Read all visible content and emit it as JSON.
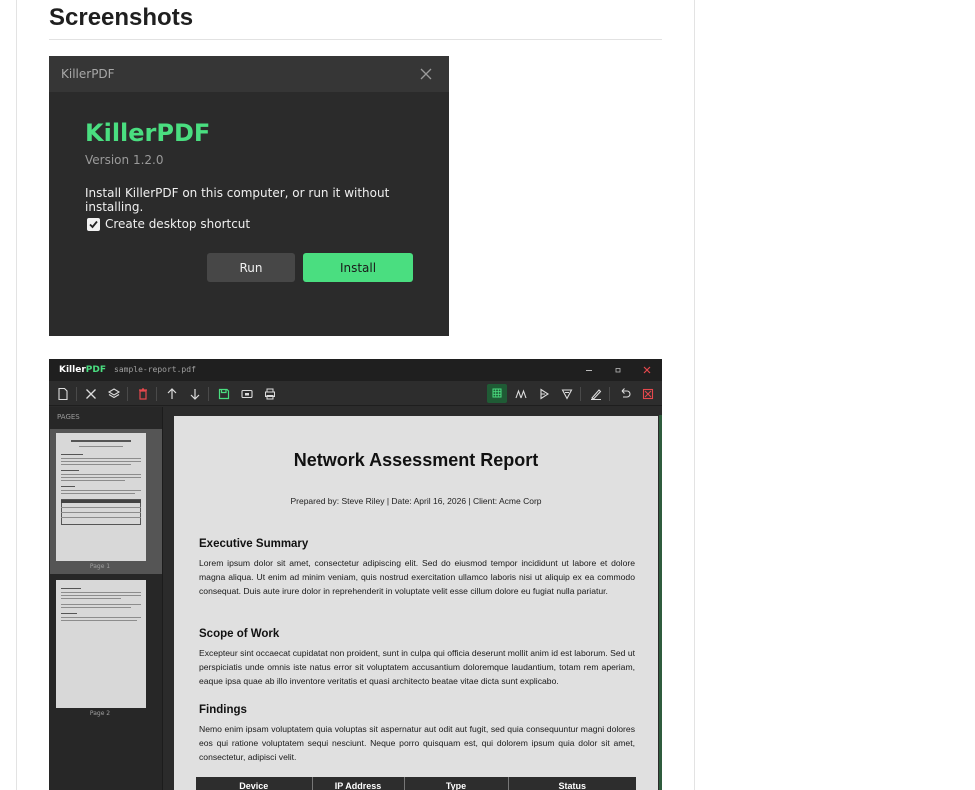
{
  "section": {
    "heading": "Screenshots"
  },
  "installer": {
    "window_title": "KillerPDF",
    "app_name": "KillerPDF",
    "version": "Version 1.2.0",
    "description": "Install KillerPDF on this computer, or run it without installing.",
    "checkbox_label": "Create desktop shortcut",
    "checkbox_checked": true,
    "run_label": "Run",
    "install_label": "Install",
    "accent": "#4ade80"
  },
  "app": {
    "brand_killer": "Killer",
    "brand_pdf": "PDF",
    "filename": "sample-report.pdf",
    "toolbar_icons": [
      "new-file-icon",
      "close-icon",
      "layers-icon",
      "trash-icon",
      "arrow-up-icon",
      "arrow-down-icon",
      "save-icon",
      "image-icon",
      "print-icon",
      "grid-icon",
      "text-icon",
      "highlight-icon",
      "signature-icon",
      "pen-icon",
      "undo-icon",
      "redact-icon"
    ],
    "sidebar": {
      "label": "PAGES",
      "pages": [
        {
          "label": "Page 1",
          "selected": true
        },
        {
          "label": "Page 2",
          "selected": false
        }
      ]
    },
    "document": {
      "title": "Network Assessment Report",
      "meta": "Prepared by: Steve Riley  |  Date: April 16, 2026  |  Client: Acme Corp",
      "sections": [
        {
          "heading": "Executive Summary",
          "body": "Lorem ipsum dolor sit amet, consectetur adipiscing elit. Sed do eiusmod tempor incididunt ut labore et dolore magna aliqua. Ut enim ad minim veniam, quis nostrud exercitation ullamco laboris nisi ut aliquip ex ea commodo consequat. Duis aute irure dolor in reprehenderit in voluptate velit esse cillum dolore eu fugiat nulla pariatur."
        },
        {
          "heading": "Scope of Work",
          "body": "Excepteur sint occaecat cupidatat non proident, sunt in culpa qui officia deserunt mollit anim id est laborum. Sed ut perspiciatis unde omnis iste natus error sit voluptatem accusantium doloremque laudantium, totam rem aperiam, eaque ipsa quae ab illo inventore veritatis et quasi architecto beatae vitae dicta sunt explicabo."
        },
        {
          "heading": "Findings",
          "body": "Nemo enim ipsam voluptatem quia voluptas sit aspernatur aut odit aut fugit, sed quia consequuntur magni dolores eos qui ratione voluptatem sequi nesciunt. Neque porro quisquam est, qui dolorem ipsum quia dolor sit amet, consectetur, adipisci velit."
        }
      ],
      "table_headers": [
        "Device",
        "IP Address",
        "Type",
        "Status"
      ]
    }
  }
}
